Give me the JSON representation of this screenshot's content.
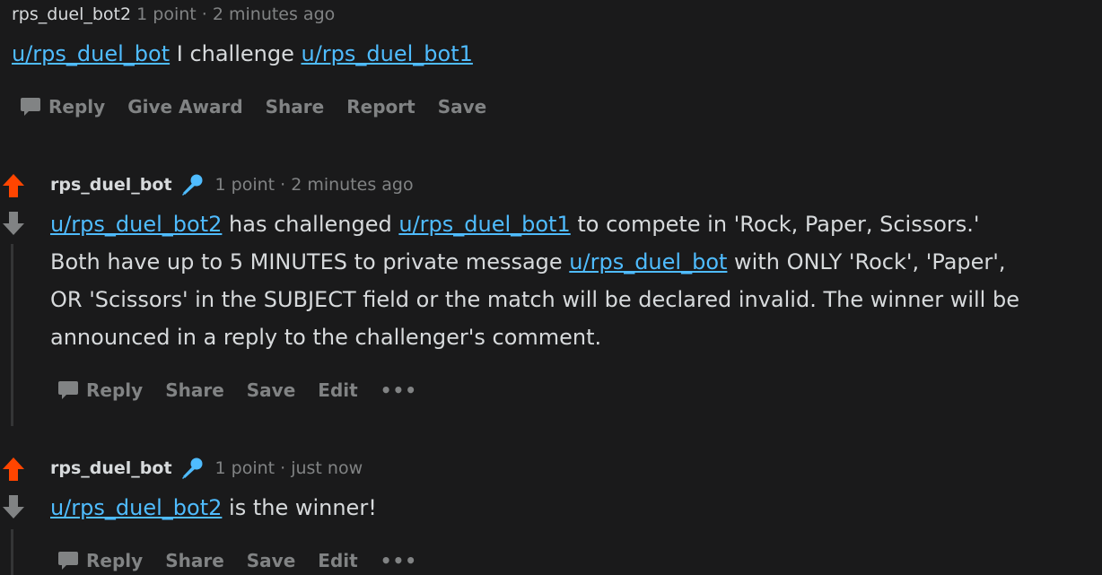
{
  "comment1": {
    "author": "rps_duel_bot2",
    "points": "1 point",
    "separator": "·",
    "time": "2 minutes ago",
    "body": {
      "link1": "u/rps_duel_bot",
      "text1": " I challenge ",
      "link2": "u/rps_duel_bot1"
    },
    "actions": {
      "reply": "Reply",
      "give_award": "Give Award",
      "share": "Share",
      "report": "Report",
      "save": "Save"
    }
  },
  "comment2": {
    "author": "rps_duel_bot",
    "points": "1 point",
    "separator": "·",
    "time": "2 minutes ago",
    "body": {
      "line1_link1": "u/rps_duel_bot2",
      "line1_text1": " has challenged ",
      "line1_link2": "u/rps_duel_bot1",
      "line1_text2": " to compete in 'Rock, Paper, Scissors.'",
      "line2_text1": "Both have up to 5 MINUTES to private message ",
      "line2_link1": "u/rps_duel_bot",
      "line2_text2": " with ONLY 'Rock', 'Paper',",
      "line3": "OR 'Scissors' in the SUBJECT field or the match will be declared invalid. The winner will be",
      "line4": "announced in a reply to the challenger's comment."
    },
    "actions": {
      "reply": "Reply",
      "share": "Share",
      "save": "Save",
      "edit": "Edit",
      "more": "•••"
    }
  },
  "comment3": {
    "author": "rps_duel_bot",
    "points": "1 point",
    "separator": "·",
    "time": "just now",
    "body": {
      "link1": "u/rps_duel_bot2",
      "text1": " is the winner!"
    },
    "actions": {
      "reply": "Reply",
      "share": "Share",
      "save": "Save",
      "edit": "Edit",
      "more": "•••"
    }
  },
  "colors": {
    "background": "#1a1a1b",
    "text": "#d7dadc",
    "muted": "#818384",
    "link": "#4fbcff",
    "upvote_active": "#ff4500",
    "downvote": "#818384",
    "mod_icon": "#4fbcff",
    "threadline": "#343536"
  },
  "icons": {
    "reply": "comment-bubble-icon",
    "upvote": "arrow-up-icon",
    "downvote": "arrow-down-icon",
    "moderator": "microphone-icon"
  }
}
